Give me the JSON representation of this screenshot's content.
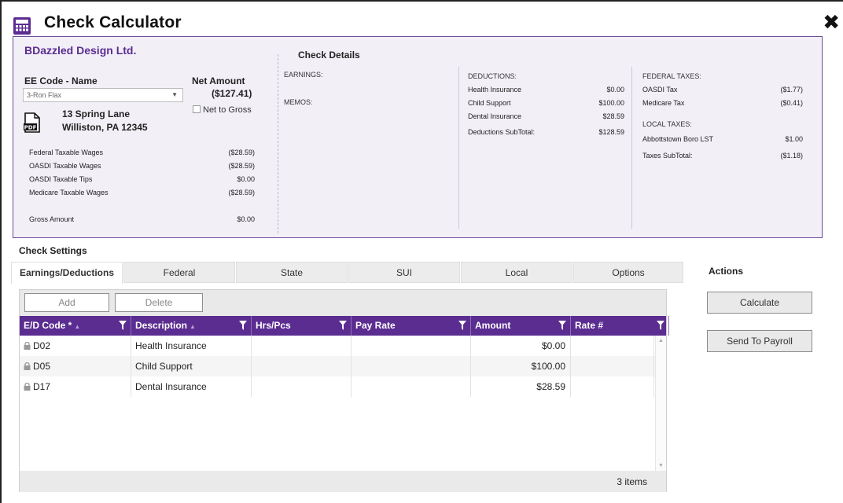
{
  "window": {
    "title": "Check Calculator",
    "close_glyph": "✖"
  },
  "summary": {
    "company": "BDazzled Design Ltd.",
    "ee_code_label": "EE Code - Name",
    "ee_selected": "3-Ron Flax",
    "net_amount_label": "Net Amount",
    "net_amount_value": "($127.41)",
    "net_to_gross_label": "Net to Gross",
    "address_line1": "13 Spring Lane",
    "address_line2": "Williston, PA 12345",
    "wages": [
      {
        "label": "Federal Taxable Wages",
        "value": "($28.59)"
      },
      {
        "label": "OASDI Taxable Wages",
        "value": "($28.59)"
      },
      {
        "label": "OASDI Taxable Tips",
        "value": "$0.00"
      },
      {
        "label": "Medicare Taxable Wages",
        "value": "($28.59)"
      }
    ],
    "gross_label": "Gross Amount",
    "gross_value": "$0.00"
  },
  "check_details": {
    "title": "Check Details",
    "earnings_label": "EARNINGS:",
    "memos_label": "MEMOS:",
    "deductions_label": "DEDUCTIONS:",
    "deductions": [
      {
        "label": "Health Insurance",
        "value": "$0.00"
      },
      {
        "label": "Child Support",
        "value": "$100.00"
      },
      {
        "label": "Dental Insurance",
        "value": "$28.59"
      }
    ],
    "deductions_subtotal_label": "Deductions SubTotal:",
    "deductions_subtotal_value": "$128.59",
    "federal_taxes_label": "FEDERAL TAXES:",
    "federal_taxes": [
      {
        "label": "OASDI Tax",
        "value": "($1.77)"
      },
      {
        "label": "Medicare Tax",
        "value": "($0.41)"
      }
    ],
    "local_taxes_label": "LOCAL TAXES:",
    "local_taxes": [
      {
        "label": "Abbottstown Boro LST",
        "value": "$1.00"
      }
    ],
    "taxes_subtotal_label": "Taxes SubTotal:",
    "taxes_subtotal_value": "($1.18)"
  },
  "check_settings": {
    "title": "Check Settings",
    "tabs": [
      "Earnings/Deductions",
      "Federal",
      "State",
      "SUI",
      "Local",
      "Options"
    ],
    "active_tab": "Earnings/Deductions"
  },
  "actions": {
    "label": "Actions",
    "calculate": "Calculate",
    "send_to_payroll": "Send To Payroll"
  },
  "grid": {
    "add_label": "Add",
    "delete_label": "Delete",
    "columns": [
      "E/D Code *",
      "Description",
      "Hrs/Pcs",
      "Pay Rate",
      "Amount",
      "Rate #"
    ],
    "rows": [
      {
        "code": "D02",
        "description": "Health Insurance",
        "hrs": "",
        "rate": "",
        "amount": "$0.00",
        "rate_no": ""
      },
      {
        "code": "D05",
        "description": "Child Support",
        "hrs": "",
        "rate": "",
        "amount": "$100.00",
        "rate_no": ""
      },
      {
        "code": "D17",
        "description": "Dental Insurance",
        "hrs": "",
        "rate": "",
        "amount": "$28.59",
        "rate_no": ""
      }
    ],
    "item_count": "3 items"
  },
  "colors": {
    "accent": "#5b2d91",
    "panel_bg": "#f2eff7"
  }
}
